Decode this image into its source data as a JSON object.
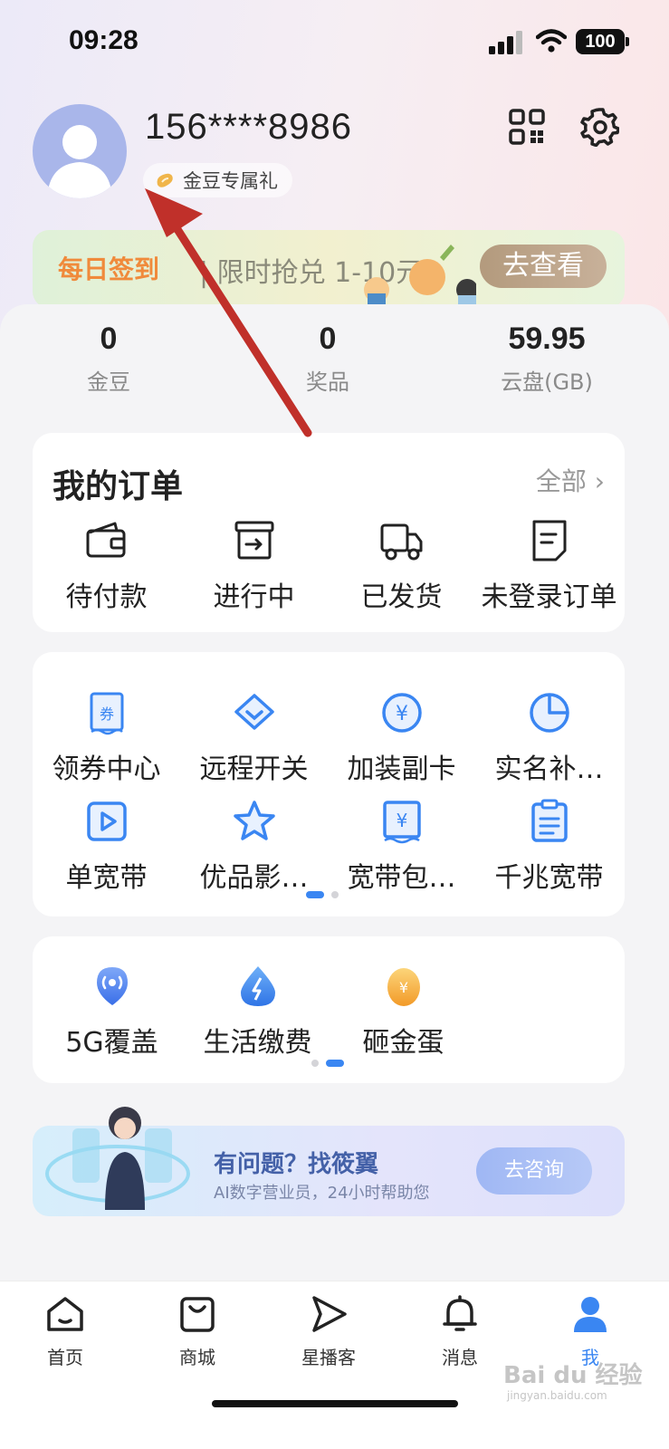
{
  "status_bar": {
    "time": "09:28",
    "battery": "100"
  },
  "profile": {
    "phone": "156****8986",
    "bean_pill": "金豆专属礼"
  },
  "banner": {
    "title": "每日签到",
    "subtitle": "| 限时抢兑 1-10元",
    "button": "去查看"
  },
  "stats": [
    {
      "value": "0",
      "label": "金豆"
    },
    {
      "value": "0",
      "label": "奖品"
    },
    {
      "value": "59.95",
      "label": "云盘(GB)"
    }
  ],
  "orders": {
    "title": "我的订单",
    "all_label": "全部 ›",
    "items": [
      {
        "label": "待付款",
        "icon": "wallet-icon"
      },
      {
        "label": "进行中",
        "icon": "box-arrow-icon"
      },
      {
        "label": "已发货",
        "icon": "truck-icon"
      },
      {
        "label": "未登录订单",
        "icon": "document-icon"
      }
    ]
  },
  "services": {
    "items": [
      {
        "label": "领券中心",
        "icon": "coupon-icon"
      },
      {
        "label": "远程开关",
        "icon": "diamond-icon"
      },
      {
        "label": "加装副卡",
        "icon": "yuan-circle-icon"
      },
      {
        "label": "实名补…",
        "icon": "pie-chart-icon"
      },
      {
        "label": "单宽带",
        "icon": "play-icon"
      },
      {
        "label": "优品影…",
        "icon": "star-icon"
      },
      {
        "label": "宽带包…",
        "icon": "yuan-receipt-icon"
      },
      {
        "label": "千兆宽带",
        "icon": "clipboard-icon"
      }
    ]
  },
  "mini_services": {
    "items": [
      {
        "label": "5G覆盖",
        "icon": "signal-pin-icon"
      },
      {
        "label": "生活缴费",
        "icon": "drop-icon"
      },
      {
        "label": "砸金蛋",
        "icon": "golden-egg-icon"
      }
    ]
  },
  "assistant": {
    "title": "有问题？找筱翼",
    "subtitle": "AI数字营业员，24小时帮助您",
    "button": "去咨询"
  },
  "tabbar": [
    {
      "label": "首页",
      "icon": "home-icon"
    },
    {
      "label": "商城",
      "icon": "shopping-bag-icon"
    },
    {
      "label": "星播客",
      "icon": "play-arrow-icon"
    },
    {
      "label": "消息",
      "icon": "bell-icon"
    },
    {
      "label": "我",
      "icon": "person-icon"
    }
  ],
  "watermark": {
    "text": "Bai du 经验",
    "sub": "jingyan.baidu.com"
  },
  "colors": {
    "accent": "#3a86f2",
    "arrow": "#c0302a",
    "banner_orange": "#f08a3b"
  }
}
